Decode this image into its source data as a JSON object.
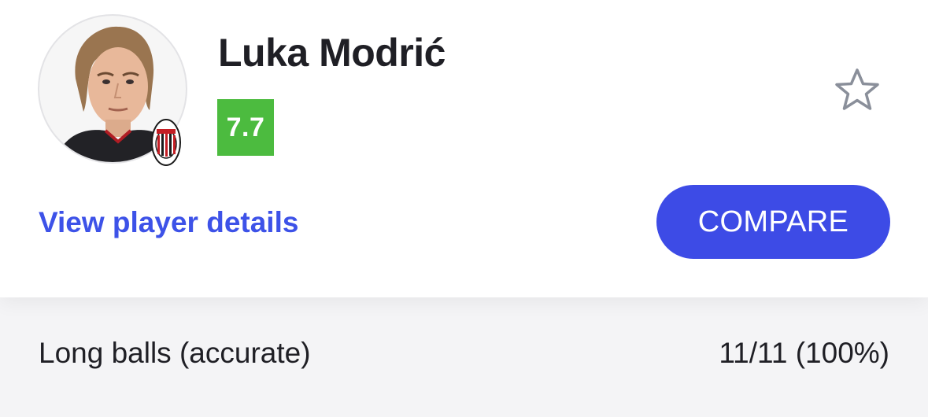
{
  "player": {
    "name": "Luka Modrić",
    "rating": "7.7",
    "rating_color": "#4cbb3f",
    "club_badge_icon": "ac-milan-crest-icon"
  },
  "actions": {
    "details_link": "View player details",
    "compare_label": "COMPARE",
    "accent_color": "#3d4be6",
    "favorite_icon": "star-outline-icon"
  },
  "stat": {
    "label": "Long balls (accurate)",
    "value": "11/11 (100%)"
  }
}
